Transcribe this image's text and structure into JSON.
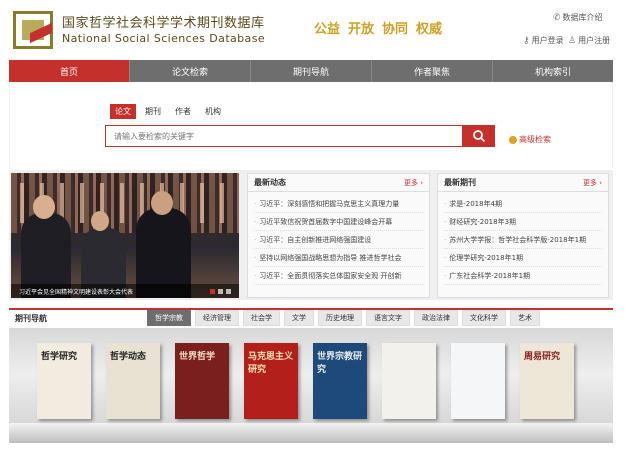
{
  "header": {
    "title_cn": "国家哲学社会科学学术期刊数据库",
    "title_en": "National Social Sciences Database",
    "slogans": [
      "公益",
      "开放",
      "协同",
      "权威"
    ],
    "intro_link": "数据库介绍",
    "login": "用户登录",
    "register": "用户注册"
  },
  "nav": {
    "items": [
      "首页",
      "论文检索",
      "期刊导航",
      "作者聚焦",
      "机构索引"
    ],
    "active_index": 0
  },
  "search": {
    "tabs": [
      "论文",
      "期刊",
      "作者",
      "机构"
    ],
    "active_tab": 0,
    "placeholder": "请输入要检索的关键字",
    "advanced": "高级检索"
  },
  "banner": {
    "caption": "习近平会见全国精神文明建设表彰大会代表"
  },
  "news": {
    "title": "最新动态",
    "more": "更多",
    "items": [
      "习近平：深刻感悟和把握马克思主义真理力量",
      "习近平致信祝贺首届数字中国建设峰会开幕",
      "习近平：自主创新推进网络强国建设",
      "坚持以网络强国战略思想为指导 推进哲学社会",
      "习近平：全面贯彻落实总体国家安全观 开创新"
    ]
  },
  "journals": {
    "title": "最新期刊",
    "more": "更多",
    "items": [
      "求是-2018年4期",
      "财经研究-2018年3期",
      "苏州大学学报：哲学社会科学版-2018年1期",
      "伦理学研究-2018年1期",
      "广东社会科学-2018年1期"
    ]
  },
  "journal_nav": {
    "title": "期刊导航",
    "categories": [
      "哲学宗教",
      "经济管理",
      "社会学",
      "文学",
      "历史地理",
      "语言文字",
      "政治法律",
      "文化科学",
      "艺术"
    ],
    "active_index": 0
  },
  "books": [
    {
      "title": "哲学研究",
      "bg": "#f1ecdf",
      "fg": "#222"
    },
    {
      "title": "哲学动态",
      "bg": "#e7e2d2",
      "fg": "#222"
    },
    {
      "title": "世界哲学",
      "bg": "#7a1e1e",
      "fg": "#f2e0c0"
    },
    {
      "title": "马克思主义研究",
      "bg": "#b3201c",
      "fg": "#f7e6b0"
    },
    {
      "title": "世界宗教研究",
      "bg": "#1e4a7a",
      "fg": "#e8eef5"
    },
    {
      "title": "",
      "bg": "#f3f1ec",
      "fg": "#333"
    },
    {
      "title": "",
      "bg": "#f4f6f8",
      "fg": "#333"
    },
    {
      "title": "周易研究",
      "bg": "#eee7d8",
      "fg": "#8a2020"
    }
  ],
  "colors": {
    "accent": "#c4302b",
    "nav_gray": "#6e6e6e",
    "slogan": "#c9a227"
  }
}
